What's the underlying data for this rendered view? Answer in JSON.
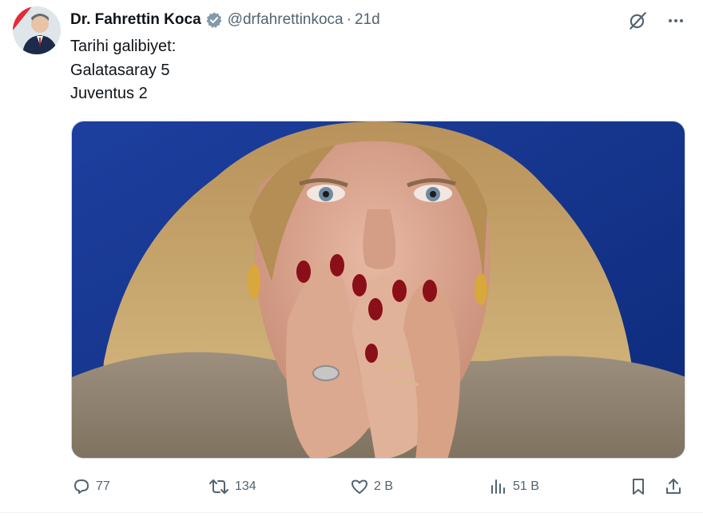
{
  "tweet": {
    "author": {
      "name": "Dr. Fahrettin Koca",
      "handle": "@drfahrettinkoca",
      "time": "21d",
      "separator": "·",
      "verified": true,
      "avatar_icon": "person-avatar"
    },
    "text_lines": [
      "Tarihi galibiyet:",
      "Galatasaray 5",
      "Juventus 2"
    ],
    "media": {
      "type": "photo",
      "icon": "photo-image"
    },
    "top_actions": [
      "grok-icon",
      "more-icon"
    ],
    "actions": {
      "reply": {
        "icon": "reply-icon",
        "count": "77"
      },
      "retweet": {
        "icon": "retweet-icon",
        "count": "134"
      },
      "like": {
        "icon": "heart-icon",
        "count": "2 B"
      },
      "views": {
        "icon": "views-icon",
        "count": "51 B"
      },
      "bookmark": {
        "icon": "bookmark-icon"
      },
      "share": {
        "icon": "share-icon"
      }
    }
  },
  "colors": {
    "text_primary": "#0f1419",
    "text_secondary": "#536471",
    "verified": "#829aab",
    "divider": "#eff3f4"
  }
}
